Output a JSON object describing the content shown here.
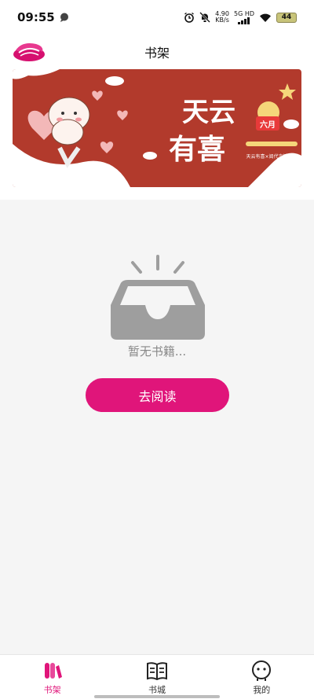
{
  "status_bar": {
    "time": "09:55",
    "net_speed_value": "4.90",
    "net_speed_unit": "KB/s",
    "network_type": "5G HD",
    "battery": "44"
  },
  "header": {
    "title": "书架"
  },
  "banner": {
    "headline_line1": "天云",
    "headline_line2": "有喜",
    "badge": "六月",
    "caption": "天云有喜×阅代言情"
  },
  "empty_state": {
    "message": "暂无书籍...",
    "button_label": "去阅读"
  },
  "bottom_nav": {
    "items": [
      {
        "label": "书架",
        "icon": "bookshelf-icon",
        "active": true
      },
      {
        "label": "书城",
        "icon": "book-city-icon",
        "active": false
      },
      {
        "label": "我的",
        "icon": "profile-icon",
        "active": false
      }
    ]
  },
  "colors": {
    "accent": "#e0157a",
    "banner_red": "#b23a2c",
    "empty_gray": "#9e9e9e"
  }
}
